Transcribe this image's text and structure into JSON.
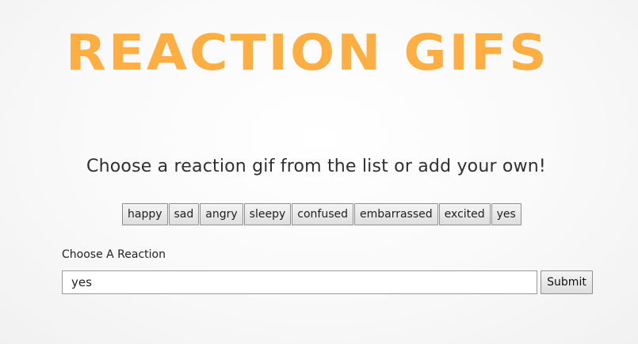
{
  "header": {
    "title": "REACTION GIFS"
  },
  "main": {
    "subtitle": "Choose a reaction gif from the list or add your own!",
    "reaction_buttons": [
      {
        "label": "happy"
      },
      {
        "label": "sad"
      },
      {
        "label": "angry"
      },
      {
        "label": "sleepy"
      },
      {
        "label": "confused"
      },
      {
        "label": "embarrassed"
      },
      {
        "label": "excited"
      },
      {
        "label": "yes"
      }
    ],
    "form": {
      "label": "Choose A Reaction",
      "input_value": "yes",
      "submit_label": "Submit"
    }
  },
  "colors": {
    "title_color": "#ffae42",
    "text_color": "#2f2f2f"
  }
}
